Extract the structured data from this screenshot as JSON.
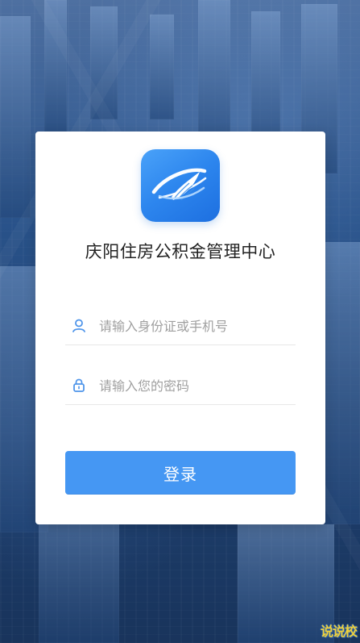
{
  "card": {
    "title": "庆阳住房公积金管理中心"
  },
  "login": {
    "username_placeholder": "请输入身份证或手机号",
    "password_placeholder": "请输入您的密码",
    "button_label": "登录"
  },
  "watermark": {
    "text": "说说校"
  },
  "icons": {
    "logo": "feather-orbit-icon",
    "user": "user-icon",
    "lock": "lock-icon"
  },
  "colors": {
    "primary": "#4597f3",
    "logo_start": "#4aa2f9",
    "logo_end": "#1d6fe0",
    "card_bg": "#ffffff"
  }
}
